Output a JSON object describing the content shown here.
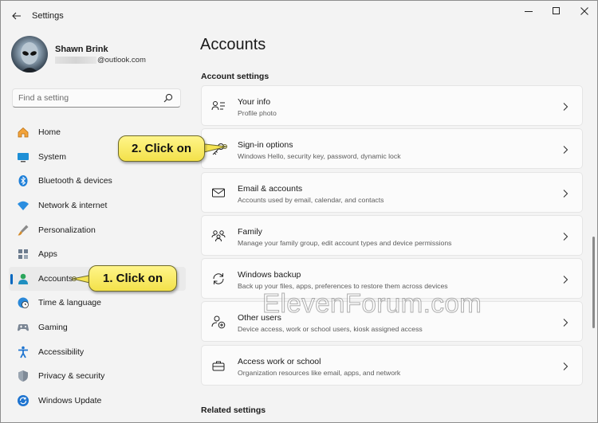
{
  "app": {
    "title": "Settings"
  },
  "profile": {
    "name": "Shawn Brink",
    "email": "@outlook.com"
  },
  "search": {
    "placeholder": "Find a setting"
  },
  "nav": {
    "items": [
      {
        "label": "Home",
        "icon": "home-icon"
      },
      {
        "label": "System",
        "icon": "monitor-icon"
      },
      {
        "label": "Bluetooth & devices",
        "icon": "bluetooth-icon"
      },
      {
        "label": "Network & internet",
        "icon": "wifi-icon"
      },
      {
        "label": "Personalization",
        "icon": "brush-icon"
      },
      {
        "label": "Apps",
        "icon": "apps-icon"
      },
      {
        "label": "Accounts",
        "icon": "person-icon",
        "active": true
      },
      {
        "label": "Time & language",
        "icon": "globe-clock-icon"
      },
      {
        "label": "Gaming",
        "icon": "gamepad-icon"
      },
      {
        "label": "Accessibility",
        "icon": "accessibility-icon"
      },
      {
        "label": "Privacy & security",
        "icon": "shield-icon"
      },
      {
        "label": "Windows Update",
        "icon": "update-icon"
      }
    ]
  },
  "main": {
    "title": "Accounts",
    "section": "Account settings",
    "cards": [
      {
        "title": "Your info",
        "subtitle": "Profile photo",
        "icon": "person-info-icon"
      },
      {
        "title": "Sign-in options",
        "subtitle": "Windows Hello, security key, password, dynamic lock",
        "icon": "key-icon"
      },
      {
        "title": "Email & accounts",
        "subtitle": "Accounts used by email, calendar, and contacts",
        "icon": "mail-icon"
      },
      {
        "title": "Family",
        "subtitle": "Manage your family group, edit account types and device permissions",
        "icon": "family-icon"
      },
      {
        "title": "Windows backup",
        "subtitle": "Back up your files, apps, preferences to restore them across devices",
        "icon": "sync-icon"
      },
      {
        "title": "Other users",
        "subtitle": "Device access, work or school users, kiosk assigned access",
        "icon": "add-person-icon"
      },
      {
        "title": "Access work or school",
        "subtitle": "Organization resources like email, apps, and network",
        "icon": "briefcase-icon"
      }
    ],
    "related": "Related settings"
  },
  "callouts": {
    "step1": "1. Click on",
    "step2": "2. Click on"
  },
  "watermark": "ElevenForum.com",
  "colors": {
    "accent": "#0067c0",
    "callout": "#f7e85a",
    "window": "#f3f3f3"
  }
}
